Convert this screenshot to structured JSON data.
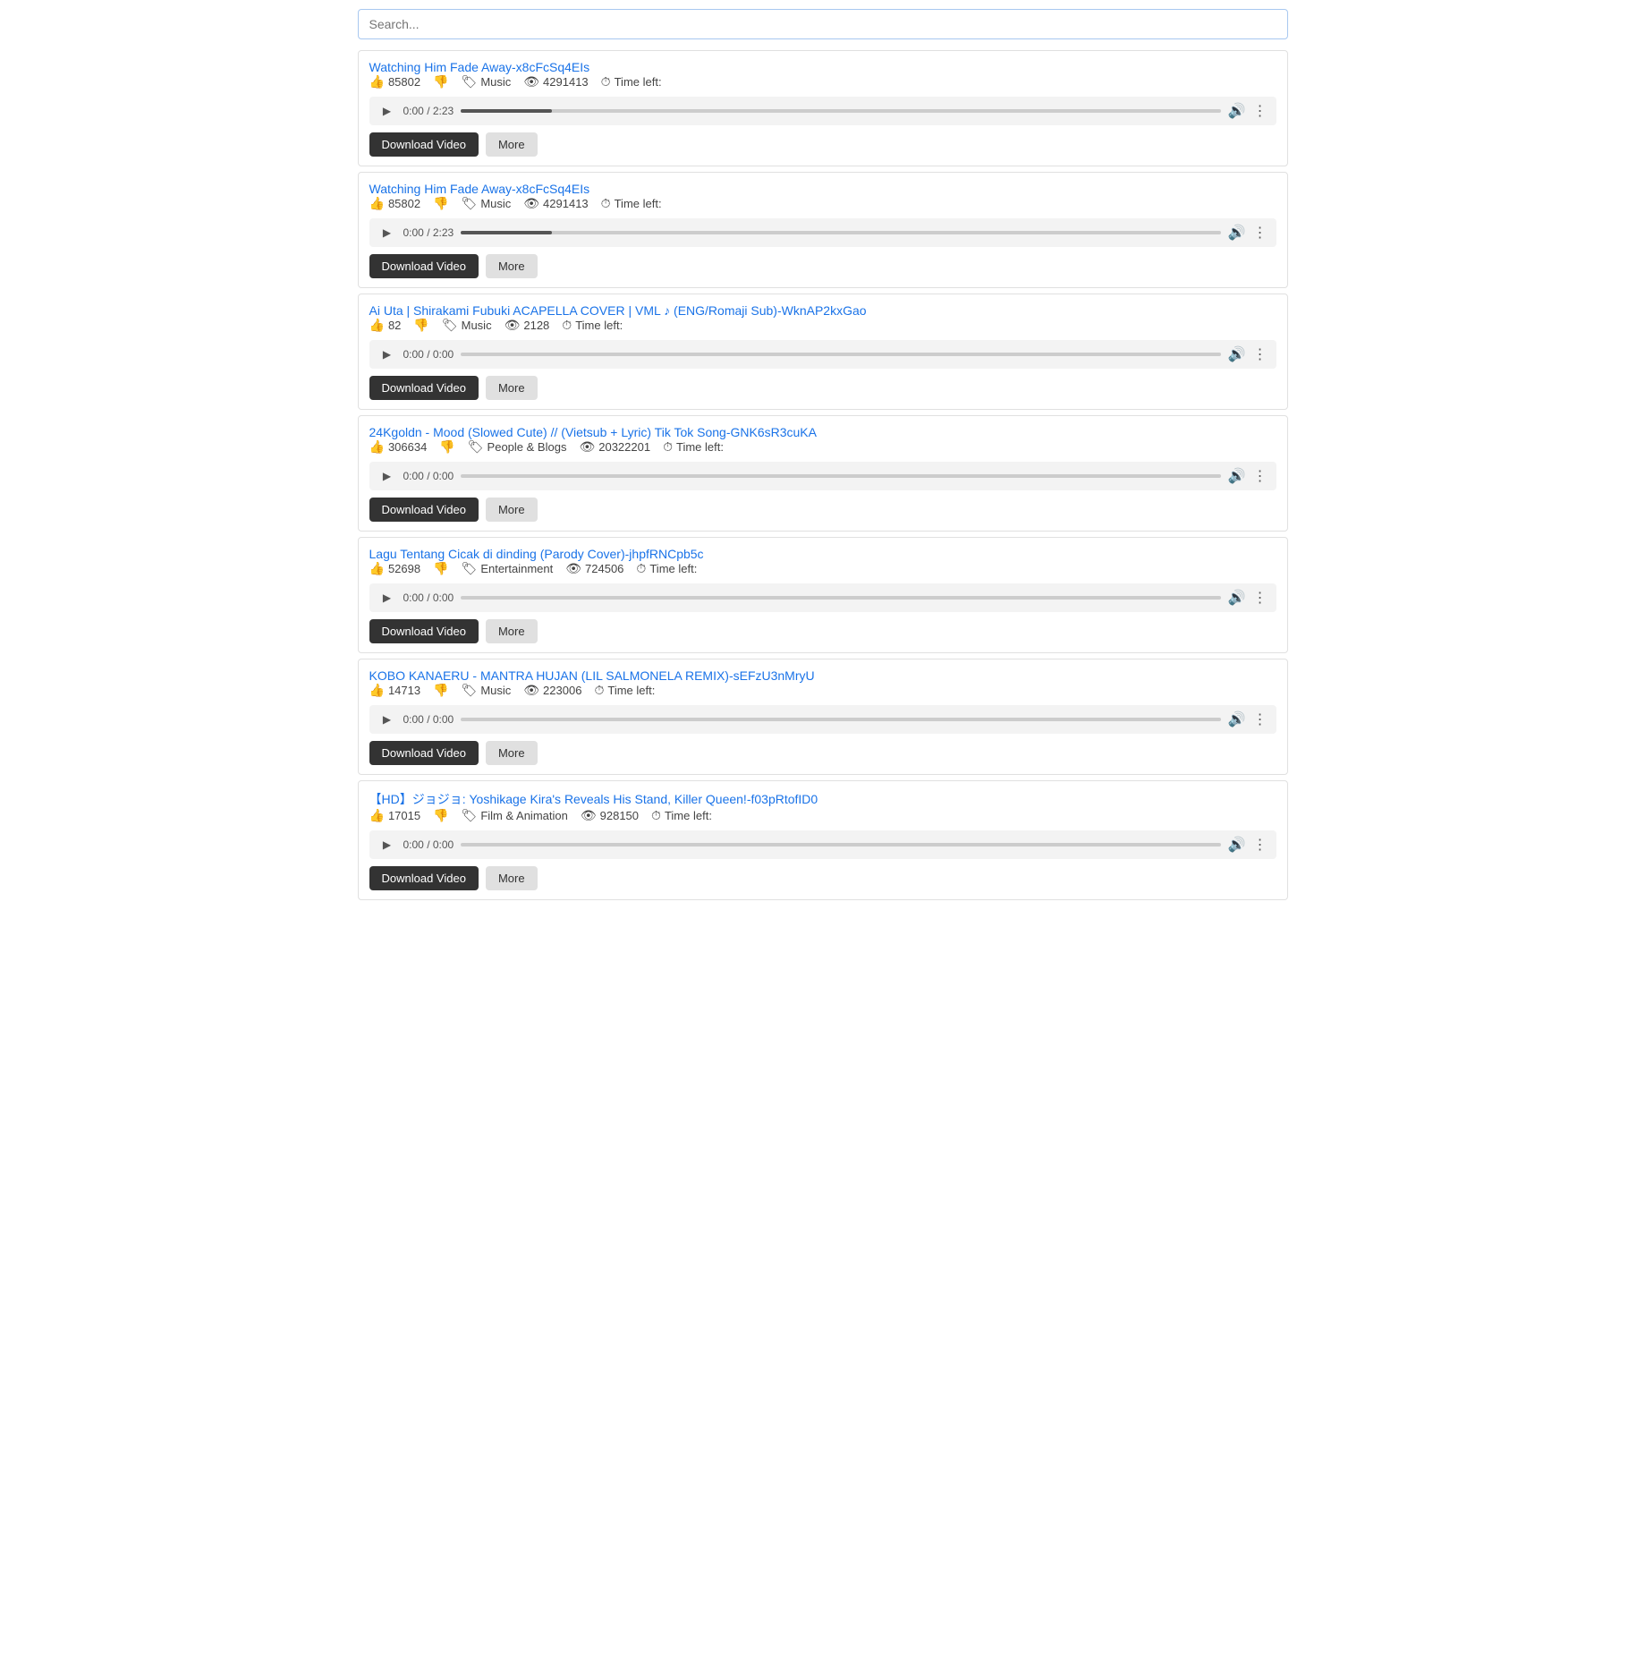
{
  "search": {
    "placeholder": "Search...",
    "value": ""
  },
  "buttons": {
    "download": "Download Video",
    "more": "More"
  },
  "videos": [
    {
      "id": "v1",
      "title": "Watching Him Fade Away-x8cFcSq4EIs",
      "likes": "85802",
      "category": "Music",
      "views": "4291413",
      "time_left": "Time left:",
      "time_current": "0:00",
      "time_total": "2:23",
      "progress_pct": 12,
      "has_progress": true
    },
    {
      "id": "v2",
      "title": "Watching Him Fade Away-x8cFcSq4EIs",
      "likes": "85802",
      "category": "Music",
      "views": "4291413",
      "time_left": "Time left:",
      "time_current": "0:00",
      "time_total": "2:23",
      "progress_pct": 12,
      "has_progress": true
    },
    {
      "id": "v3",
      "title": "Ai Uta | Shirakami Fubuki ACAPELLA COVER | VML ♪ (ENG/Romaji Sub)-WknAP2kxGao",
      "likes": "82",
      "category": "Music",
      "views": "2128",
      "time_left": "Time left:",
      "time_current": "0:00",
      "time_total": "0:00",
      "progress_pct": 0,
      "has_progress": false
    },
    {
      "id": "v4",
      "title": "24Kgoldn - Mood (Slowed Cute) // (Vietsub + Lyric) Tik Tok Song-GNK6sR3cuKA",
      "likes": "306634",
      "category": "People & Blogs",
      "views": "20322201",
      "time_left": "Time left:",
      "time_current": "0:00",
      "time_total": "0:00",
      "progress_pct": 0,
      "has_progress": false
    },
    {
      "id": "v5",
      "title": "Lagu Tentang Cicak di dinding (Parody Cover)-jhpfRNCpb5c",
      "likes": "52698",
      "category": "Entertainment",
      "views": "724506",
      "time_left": "Time left:",
      "time_current": "0:00",
      "time_total": "0:00",
      "progress_pct": 0,
      "has_progress": false
    },
    {
      "id": "v6",
      "title": "KOBO KANAERU - MANTRA HUJAN (LIL SALMONELA REMIX)-sEFzU3nMryU",
      "likes": "14713",
      "category": "Music",
      "views": "223006",
      "time_left": "Time left:",
      "time_current": "0:00",
      "time_total": "0:00",
      "progress_pct": 0,
      "has_progress": false
    },
    {
      "id": "v7",
      "title": "【HD】ジョジョ: Yoshikage Kira's Reveals His Stand, Killer Queen!-f03pRtofID0",
      "likes": "17015",
      "category": "Film & Animation",
      "views": "928150",
      "time_left": "Time left:",
      "time_current": "0:00",
      "time_total": "0:00",
      "progress_pct": 0,
      "has_progress": false
    }
  ],
  "icons": {
    "like": "👍",
    "dislike": "👎",
    "tag": "🏷",
    "eye": "👁",
    "clock": "⏱",
    "play": "▶",
    "pause": "⏸",
    "volume": "🔊",
    "more_vert": "⋮"
  }
}
